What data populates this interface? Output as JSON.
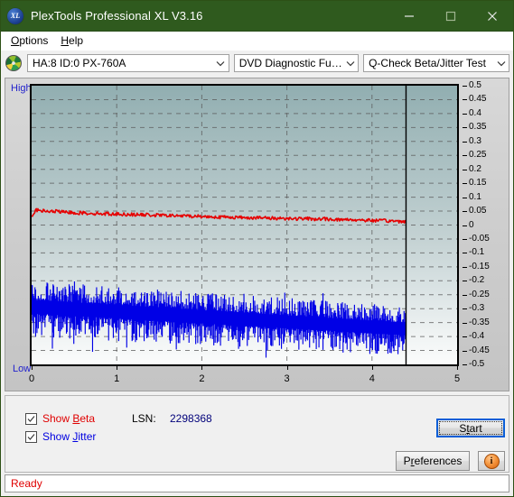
{
  "window": {
    "title": "PlexTools Professional XL V3.16",
    "logo_text": "XL",
    "minimize_icon": "minimize-icon",
    "maximize_icon": "maximize-icon",
    "close_icon": "close-icon"
  },
  "menu": {
    "items": [
      {
        "label": "Options",
        "accel": "O"
      },
      {
        "label": "Help",
        "accel": "H"
      }
    ]
  },
  "toolbar": {
    "disc_icon": "disc-icon",
    "drive": {
      "value": "HA:8 ID:0  PX-760A",
      "options": [
        "HA:8 ID:0  PX-760A"
      ]
    },
    "function": {
      "value": "DVD Diagnostic Functions",
      "options": [
        "DVD Diagnostic Functions"
      ]
    },
    "test": {
      "value": "Q-Check Beta/Jitter Test",
      "options": [
        "Q-Check Beta/Jitter Test"
      ]
    }
  },
  "chart_panel": {
    "label_high": "High",
    "label_low": "Low"
  },
  "controls": {
    "show_beta": {
      "label_pre": "Show ",
      "label_accel": "B",
      "label_post": "eta",
      "checked": true
    },
    "show_jitter": {
      "label_pre": "Show ",
      "label_accel": "J",
      "label_post": "itter",
      "checked": true
    },
    "lsn_label": "LSN:",
    "lsn_value": "2298368",
    "start": {
      "label_pre": "S",
      "label_accel": "t",
      "label_post": "art"
    },
    "preferences": {
      "label_pre": "P",
      "label_accel": "r",
      "label_post": "eferences"
    },
    "info": {
      "glyph": "i",
      "name": "info-icon"
    }
  },
  "status": {
    "text": "Ready"
  },
  "chart_data": {
    "type": "line",
    "title": "Q-Check Beta/Jitter Test",
    "xlabel": "",
    "ylabel": "",
    "xlim": [
      0,
      5
    ],
    "ylim": [
      -0.5,
      0.5
    ],
    "xticks": [
      0,
      1,
      2,
      3,
      4,
      5
    ],
    "yticks": [
      0.5,
      0.45,
      0.4,
      0.35,
      0.3,
      0.25,
      0.2,
      0.15,
      0.1,
      0.05,
      0,
      -0.05,
      -0.1,
      -0.15,
      -0.2,
      -0.25,
      -0.3,
      -0.35,
      -0.4,
      -0.45,
      -0.5
    ],
    "ytick_labels": [
      "0.5",
      "0.45",
      "0.4",
      "0.35",
      "0.3",
      "0.25",
      "0.2",
      "0.15",
      "0.1",
      "0.05",
      "0",
      "-0.05",
      "-0.1",
      "-0.15",
      "-0.2",
      "-0.25",
      "-0.3",
      "-0.35",
      "-0.4",
      "-0.45",
      "-0.5"
    ],
    "grid": true,
    "grid_style": "dashed",
    "legend": [
      "Show Beta",
      "Show Jitter"
    ],
    "data_end_marker_x": 4.4,
    "series": [
      {
        "name": "Beta",
        "color": "#e60000",
        "x": [
          0.0,
          0.05,
          0.1,
          0.15,
          0.2,
          0.25,
          0.3,
          0.35,
          0.4,
          0.45,
          0.5,
          0.55,
          0.6,
          0.65,
          0.7,
          0.75,
          0.8,
          0.85,
          0.9,
          0.95,
          1.0,
          1.05,
          1.1,
          1.15,
          1.2,
          1.25,
          1.3,
          1.35,
          1.4,
          1.45,
          1.5,
          1.55,
          1.6,
          1.65,
          1.7,
          1.75,
          1.8,
          1.85,
          1.9,
          1.95,
          2.0,
          2.05,
          2.1,
          2.15,
          2.2,
          2.25,
          2.3,
          2.35,
          2.4,
          2.45,
          2.5,
          2.55,
          2.6,
          2.65,
          2.7,
          2.75,
          2.8,
          2.85,
          2.9,
          2.95,
          3.0,
          3.05,
          3.1,
          3.15,
          3.2,
          3.25,
          3.3,
          3.35,
          3.4,
          3.45,
          3.5,
          3.55,
          3.6,
          3.65,
          3.7,
          3.75,
          3.8,
          3.85,
          3.9,
          3.95,
          4.0,
          4.05,
          4.1,
          4.15,
          4.2,
          4.25,
          4.3,
          4.35,
          4.4
        ],
        "y": [
          0.04,
          0.053,
          0.052,
          0.05,
          0.049,
          0.048,
          0.05,
          0.047,
          0.045,
          0.046,
          0.044,
          0.043,
          0.044,
          0.042,
          0.043,
          0.041,
          0.042,
          0.04,
          0.041,
          0.039,
          0.04,
          0.039,
          0.038,
          0.039,
          0.037,
          0.038,
          0.036,
          0.037,
          0.036,
          0.035,
          0.036,
          0.034,
          0.035,
          0.033,
          0.034,
          0.033,
          0.032,
          0.033,
          0.031,
          0.032,
          0.03,
          0.031,
          0.029,
          0.03,
          0.028,
          0.029,
          0.028,
          0.029,
          0.027,
          0.028,
          0.026,
          0.027,
          0.026,
          0.027,
          0.025,
          0.026,
          0.024,
          0.025,
          0.024,
          0.025,
          0.023,
          0.024,
          0.022,
          0.023,
          0.022,
          0.023,
          0.021,
          0.022,
          0.021,
          0.022,
          0.02,
          0.021,
          0.019,
          0.02,
          0.019,
          0.02,
          0.018,
          0.019,
          0.017,
          0.018,
          0.016,
          0.017,
          0.015,
          0.016,
          0.014,
          0.015,
          0.013,
          0.014,
          0.013
        ],
        "avg_start": 0.05,
        "avg_end": 0.015
      },
      {
        "name": "Jitter",
        "color": "#0000e6",
        "description": "Dense noisy band; mean drifts from about -0.29 near LSN 0 to about -0.37 at the end of the recorded area, with spikes reaching -0.18 at top and -0.47 at the bottom.",
        "band_mean_start": -0.29,
        "band_mean_end": -0.37,
        "band_top_start": -0.2,
        "band_top_end": -0.29,
        "band_bottom_start": -0.4,
        "band_bottom_end": -0.47
      }
    ]
  }
}
